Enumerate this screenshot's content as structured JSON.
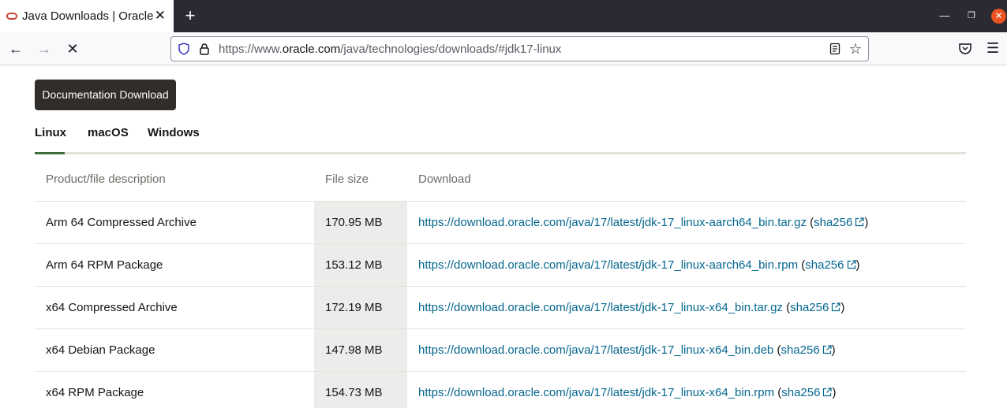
{
  "browser": {
    "tab_title": "Java Downloads | Oracle",
    "tab_close": "✕",
    "new_tab": "+",
    "url_prefix": "https://www.",
    "url_domain": "oracle.com",
    "url_path": "/java/technologies/downloads/#jdk17-linux"
  },
  "page": {
    "doc_button": "Documentation Download",
    "os_tabs": [
      "Linux",
      "macOS",
      "Windows"
    ],
    "active_tab": "Linux",
    "table": {
      "headers": [
        "Product/file description",
        "File size",
        "Download"
      ],
      "rows": [
        {
          "desc": "Arm 64 Compressed Archive",
          "size": "170.95 MB",
          "link": "https://download.oracle.com/java/17/latest/jdk-17_linux-aarch64_bin.tar.gz",
          "sha": "sha256"
        },
        {
          "desc": "Arm 64 RPM Package",
          "size": "153.12 MB",
          "link": "https://download.oracle.com/java/17/latest/jdk-17_linux-aarch64_bin.rpm",
          "sha": "sha256"
        },
        {
          "desc": "x64 Compressed Archive",
          "size": "172.19 MB",
          "link": "https://download.oracle.com/java/17/latest/jdk-17_linux-x64_bin.tar.gz",
          "sha": "sha256"
        },
        {
          "desc": "x64 Debian Package",
          "size": "147.98 MB",
          "link": "https://download.oracle.com/java/17/latest/jdk-17_linux-x64_bin.deb",
          "sha": "sha256"
        },
        {
          "desc": "x64 RPM Package",
          "size": "154.73 MB",
          "link": "https://download.oracle.com/java/17/latest/jdk-17_linux-x64_bin.rpm",
          "sha": "sha256"
        }
      ]
    }
  },
  "colors": {
    "link": "#04668e",
    "button_bg": "#312d2a",
    "active_tab_underline": "#3d6e3d",
    "size_cell_bg": "#eeeceb"
  },
  "icons": [
    "oracle-favicon-icon",
    "back-arrow-icon",
    "forward-arrow-icon",
    "stop-icon",
    "shield-icon",
    "lock-icon",
    "reader-view-icon",
    "star-icon",
    "pocket-icon",
    "hamburger-menu-icon",
    "external-link-icon"
  ]
}
